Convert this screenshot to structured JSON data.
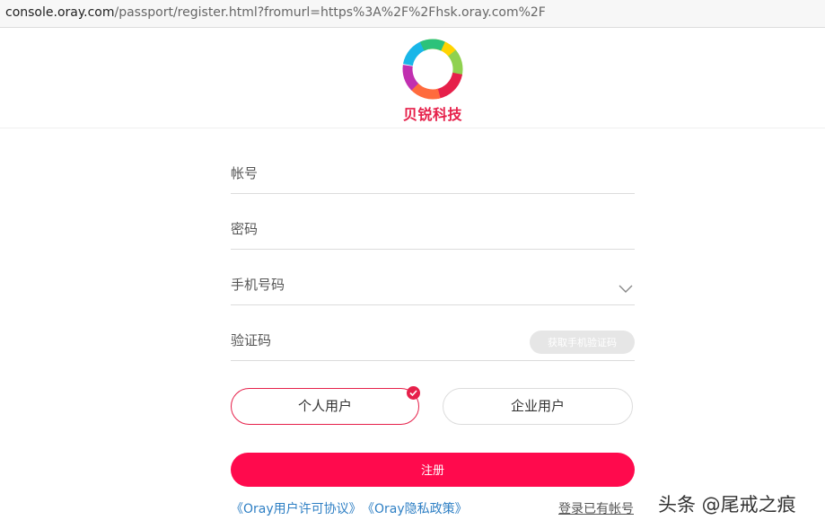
{
  "browser": {
    "url_host": "console.oray.com",
    "url_path": "/passport/register.html?fromurl=https%3A%2F%2Fhsk.oray.com%2F"
  },
  "header": {
    "brand_name": "贝锐科技"
  },
  "form": {
    "account_label": "帐号",
    "password_label": "密码",
    "phone_label": "手机号码",
    "code_label": "验证码",
    "get_code_label": "获取手机验证码",
    "personal_user_label": "个人用户",
    "company_user_label": "企业用户",
    "selected_user_type": "personal",
    "register_label": "注册"
  },
  "footer": {
    "license_agreement": "《Oray用户许可协议》",
    "privacy_policy": "《Oray隐私政策》",
    "login_link": "登录已有帐号"
  },
  "watermark": "头条 @尾戒之痕",
  "colors": {
    "accent": "#ff0a4d",
    "brand_red": "#e6204a",
    "link_blue": "#2e7fc4"
  }
}
